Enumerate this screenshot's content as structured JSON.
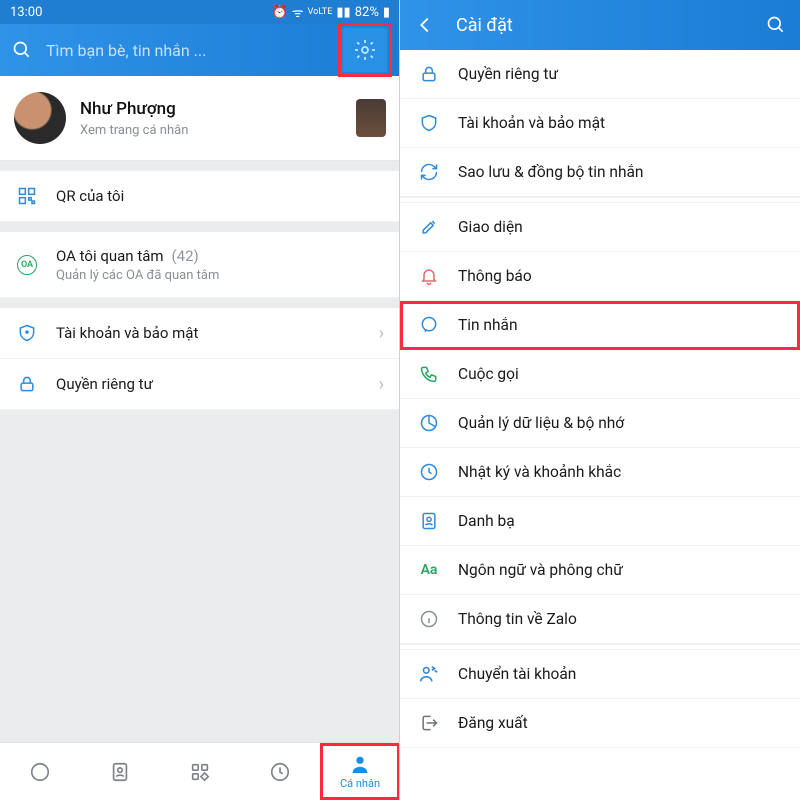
{
  "status": {
    "time": "13:00",
    "battery": "82%"
  },
  "left": {
    "search_placeholder": "Tìm bạn bè, tin nhắn ...",
    "profile": {
      "name": "Như Phượng",
      "sub": "Xem trang cá nhân"
    },
    "qr": "QR của tôi",
    "oa": {
      "title": "OA tôi quan tâm",
      "count": "(42)",
      "sub": "Quản lý các OA đã quan tâm"
    },
    "account": "Tài khoản và bảo mật",
    "privacy": "Quyền riêng tư",
    "tab_active": "Cá nhân"
  },
  "right": {
    "title": "Cài đặt",
    "items": {
      "privacy": "Quyền riêng tư",
      "account": "Tài khoản và bảo mật",
      "backup": "Sao lưu & đồng bộ tin nhắn",
      "theme": "Giao diện",
      "notif": "Thông báo",
      "message": "Tin nhắn",
      "call": "Cuộc gọi",
      "data": "Quản lý dữ liệu & bộ nhớ",
      "diary": "Nhật ký và khoảnh khắc",
      "contacts": "Danh bạ",
      "lang": "Ngôn ngữ và phông chữ",
      "about": "Thông tin về Zalo",
      "switch": "Chuyển tài khoản",
      "logout": "Đăng xuất"
    }
  }
}
